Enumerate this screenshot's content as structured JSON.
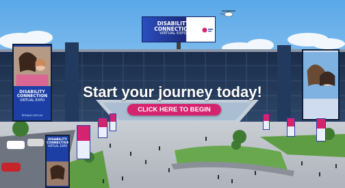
{
  "scene": {
    "hero_title": "Start your journey today!",
    "cta_label": "CLICK HERE TO BEGIN",
    "brand_line1": "DISABILITY CONNECTION",
    "brand_line2": "VIRTUAL EXPO",
    "banner_url": "dcexpo.com.au"
  },
  "colors": {
    "brand_pink": "#d5246f",
    "brand_blue": "#2c3e9b",
    "sky": "#8cc3ef"
  },
  "icons": {
    "helicopter": "helicopter-icon"
  }
}
